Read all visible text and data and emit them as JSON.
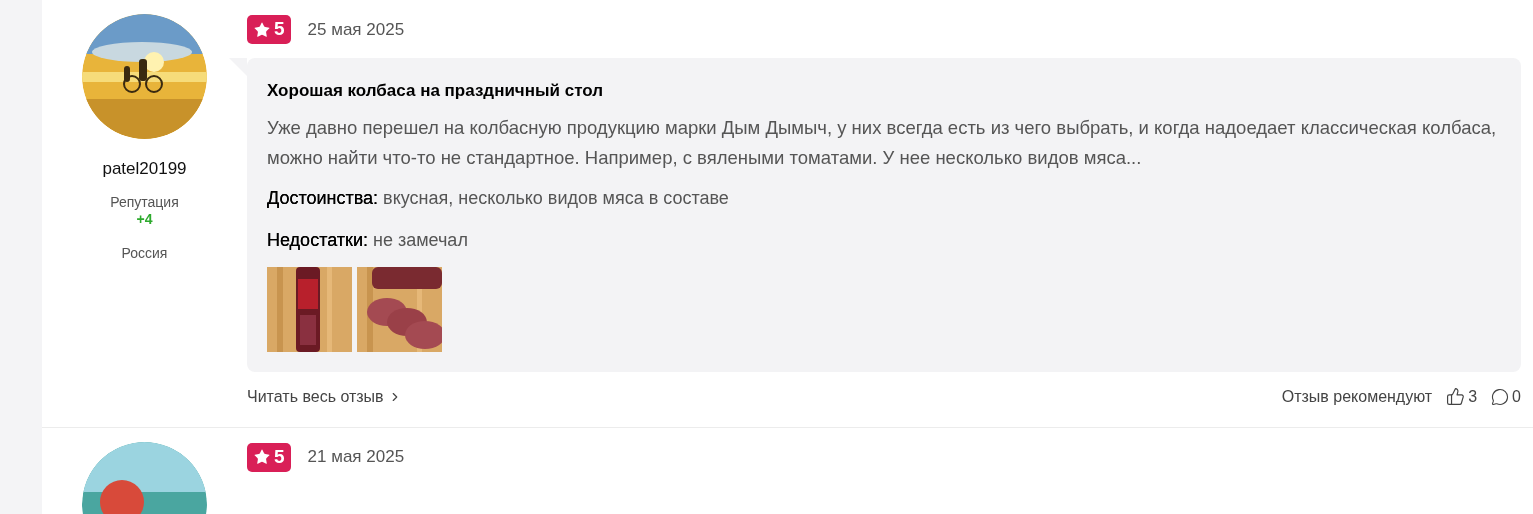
{
  "reviews": [
    {
      "author": {
        "name": "patel20199",
        "reputation_label": "Репутация",
        "reputation": "+4",
        "country": "Россия"
      },
      "rating": "5",
      "date": "25 мая 2025",
      "title": "Хорошая колбаса на праздничный стол",
      "text": "Уже давно перешел на колбасную продукцию марки Дым Дымыч, у них всегда есть из чего выбрать, и когда надоедает классическая колбаса, можно найти что-то не стандартное. Например, с вялеными томатами. У нее несколько видов мяса...",
      "pros_label": "Достоинства:",
      "pros": "вкусная, несколько видов мяса в составе",
      "cons_label": "Недостатки:",
      "cons": "не замечал",
      "read_more": "Читать весь отзыв",
      "recommend_label": "Отзыв рекомендуют",
      "likes": "3",
      "comments": "0"
    },
    {
      "rating": "5",
      "date": "21 мая 2025"
    }
  ]
}
